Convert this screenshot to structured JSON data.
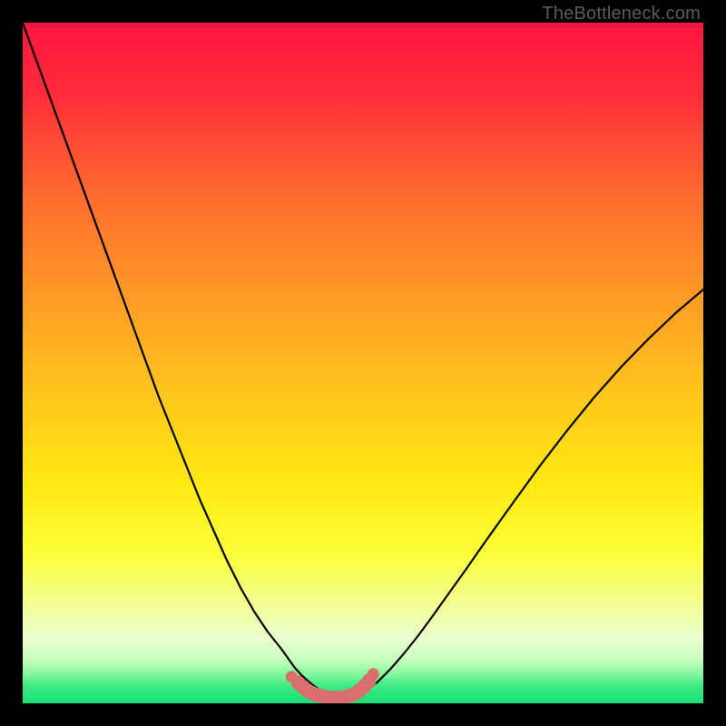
{
  "watermark": {
    "text": "TheBottleneck.com",
    "color": "#5b5b5b"
  },
  "gradient": {
    "stops": [
      {
        "offset": 0.0,
        "color": "#ff153f"
      },
      {
        "offset": 0.1,
        "color": "#ff2b3b"
      },
      {
        "offset": 0.25,
        "color": "#ff6a2f"
      },
      {
        "offset": 0.4,
        "color": "#ff9a26"
      },
      {
        "offset": 0.55,
        "color": "#ffc71c"
      },
      {
        "offset": 0.68,
        "color": "#ffe913"
      },
      {
        "offset": 0.78,
        "color": "#fdff3a"
      },
      {
        "offset": 0.86,
        "color": "#f2ff9a"
      },
      {
        "offset": 0.905,
        "color": "#eaffcf"
      },
      {
        "offset": 0.935,
        "color": "#c8ffbf"
      },
      {
        "offset": 0.955,
        "color": "#8cf7a1"
      },
      {
        "offset": 0.975,
        "color": "#3de983"
      },
      {
        "offset": 1.0,
        "color": "#17e074"
      }
    ]
  },
  "chart_data": {
    "type": "line",
    "title": "",
    "xlabel": "",
    "ylabel": "",
    "xlim": [
      0,
      100
    ],
    "ylim": [
      0,
      100
    ],
    "x": [
      0,
      2,
      4,
      6,
      8,
      10,
      12,
      14,
      16,
      18,
      20,
      22,
      24,
      26,
      28,
      30,
      32,
      34,
      36,
      38,
      40,
      41,
      42,
      43,
      44,
      45,
      46,
      47,
      48,
      49,
      50,
      52,
      54,
      56,
      58,
      60,
      62,
      65,
      68,
      72,
      76,
      80,
      84,
      88,
      92,
      96,
      100
    ],
    "values": [
      100,
      94.5,
      89,
      83.5,
      78,
      72.5,
      67,
      61.5,
      56,
      50.5,
      45,
      40,
      35,
      30,
      25.5,
      21,
      17,
      13.5,
      10.5,
      8,
      5.2,
      4.1,
      3.2,
      2.4,
      1.7,
      1.2,
      0.9,
      0.8,
      0.85,
      1.1,
      1.6,
      3.0,
      5.0,
      7.3,
      9.8,
      12.5,
      15.3,
      19.5,
      23.8,
      29.4,
      34.9,
      40.1,
      45.0,
      49.5,
      53.6,
      57.4,
      60.8
    ],
    "marker_overlay": {
      "color": "#d86f6d",
      "x": [
        39.5,
        40.5,
        41.2,
        41.8,
        42.5,
        43.3,
        44.1,
        45.0,
        45.9,
        46.8,
        47.7,
        48.6,
        49.4,
        50.2,
        50.9,
        51.5
      ],
      "y": [
        3.9,
        3.0,
        2.4,
        1.9,
        1.5,
        1.2,
        1.0,
        0.85,
        0.8,
        0.85,
        1.0,
        1.3,
        1.8,
        2.5,
        3.3,
        4.3
      ]
    }
  }
}
